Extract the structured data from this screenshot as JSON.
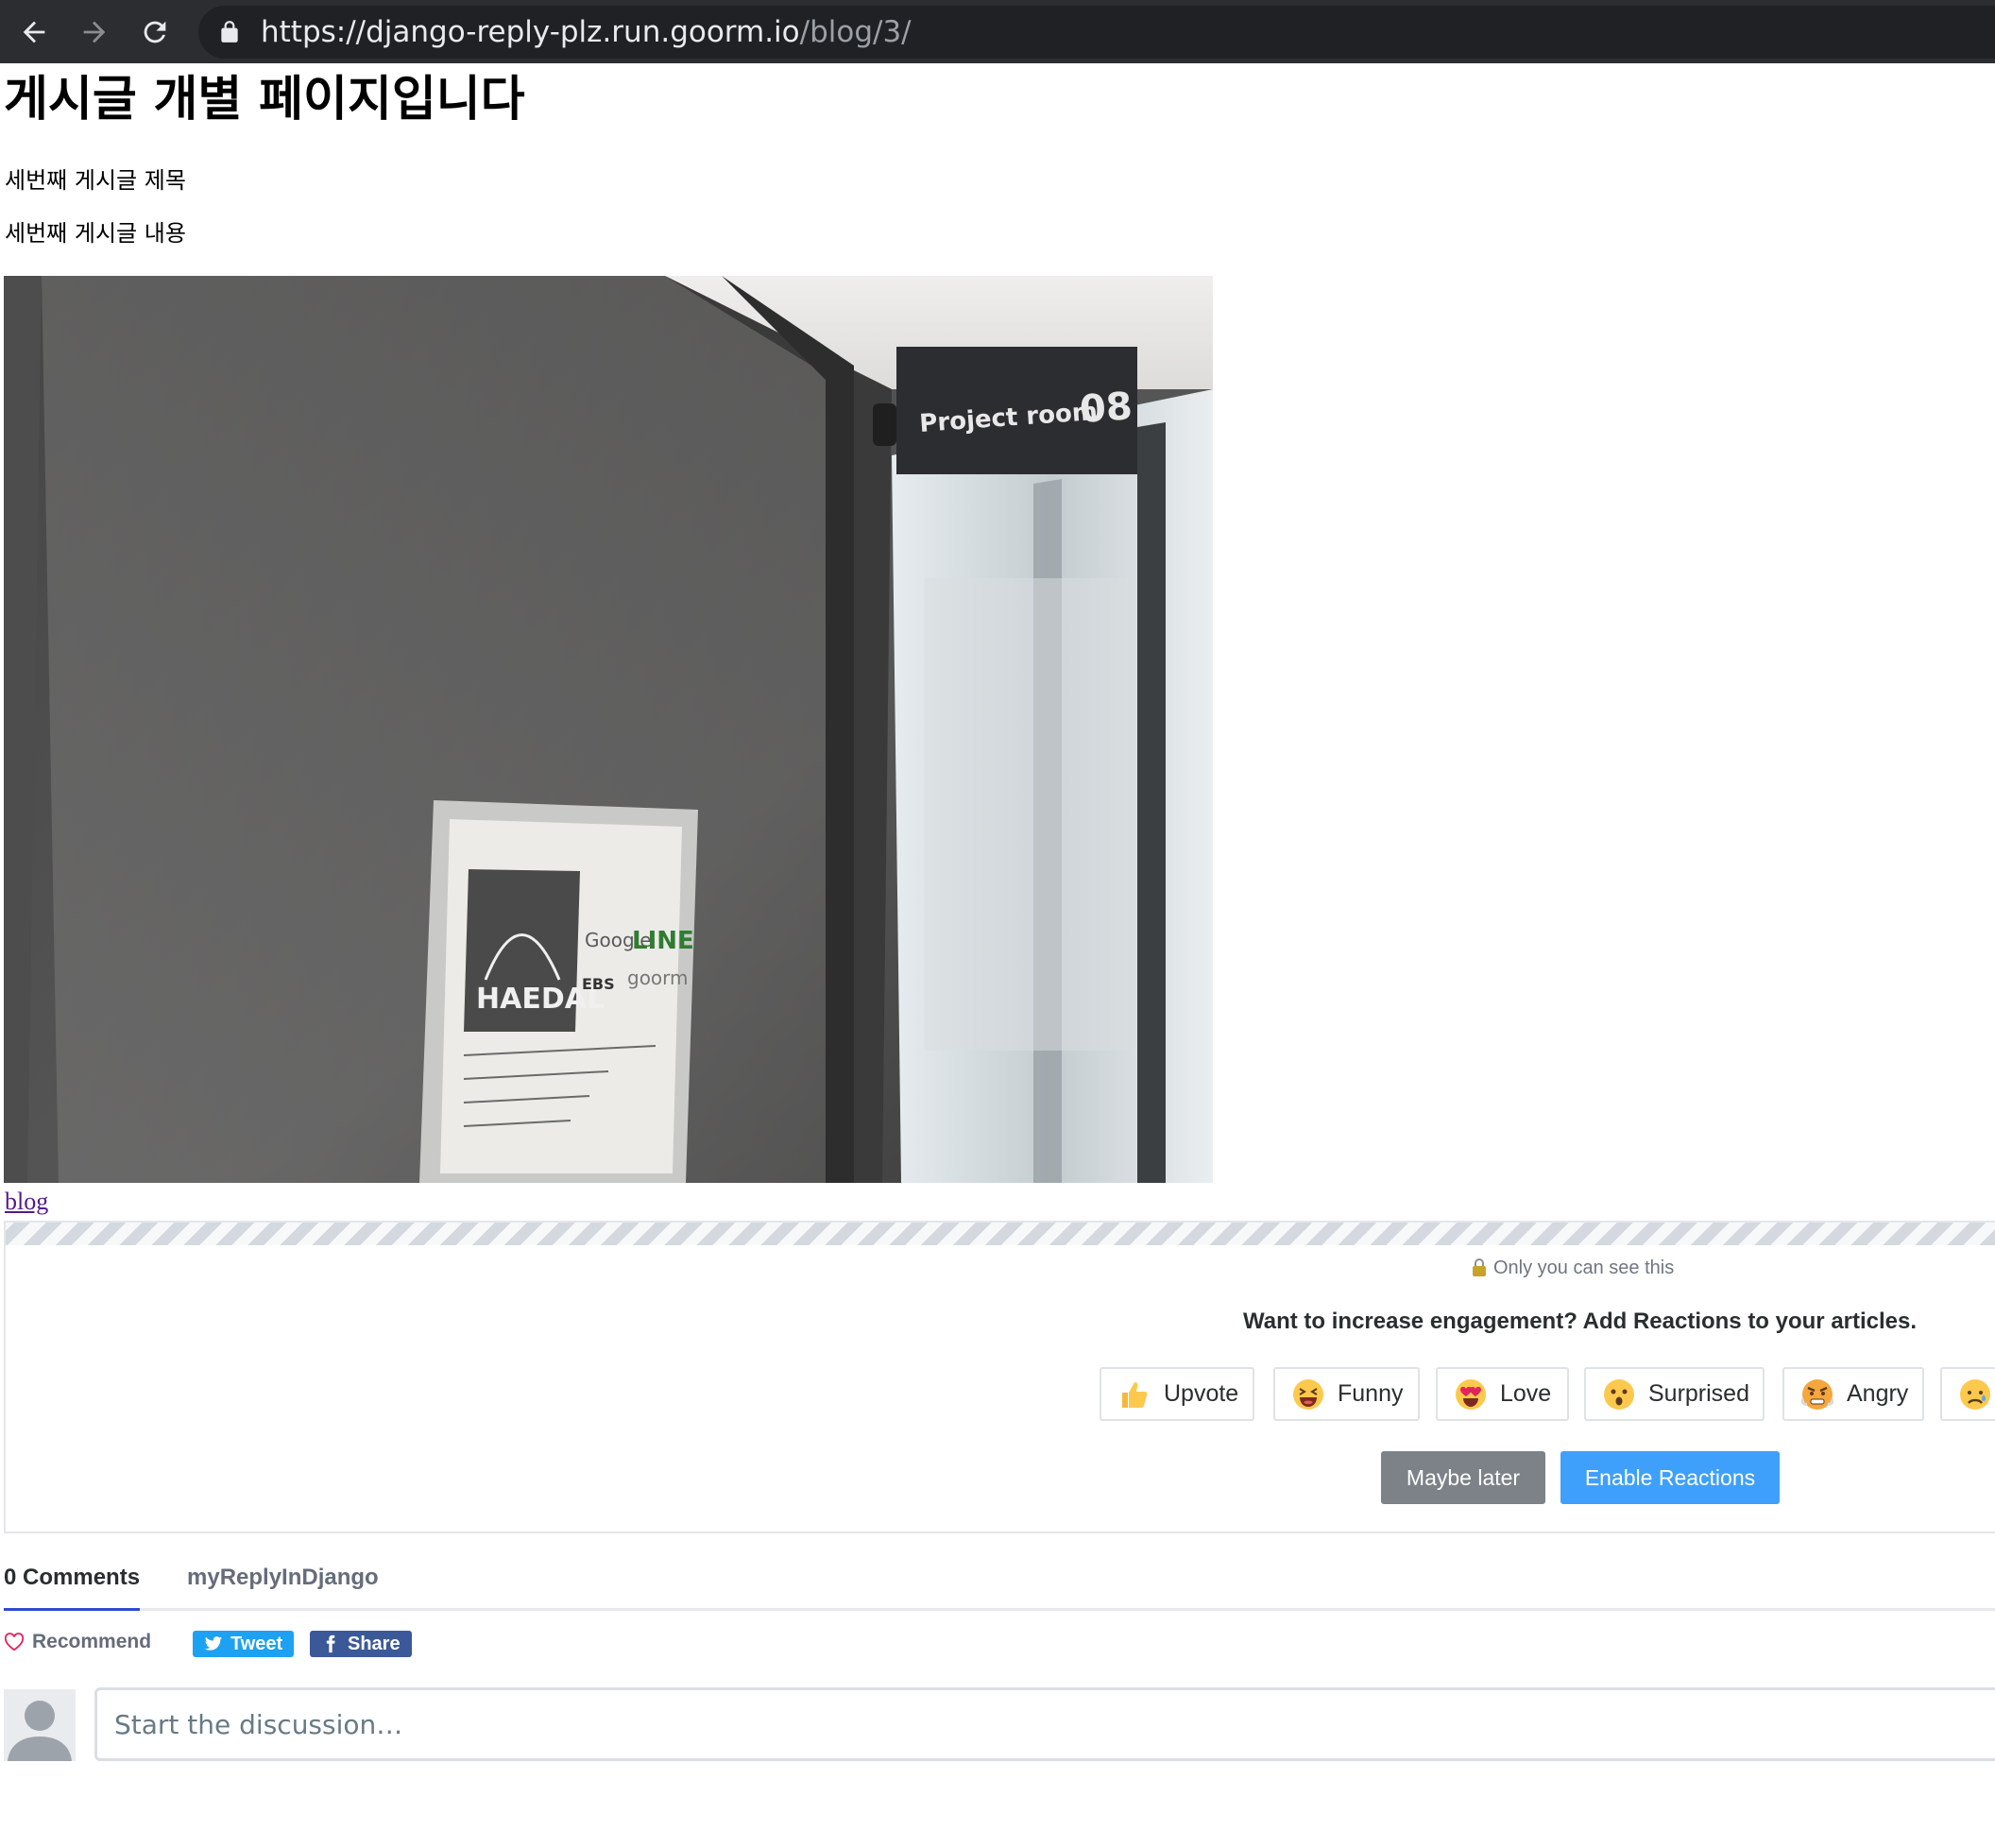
{
  "browser": {
    "url_scheme": "https://",
    "url_host": "django-reply-plz.run.goorm.io",
    "url_path": "/blog/3/"
  },
  "page": {
    "heading": "게시글 개별 페이지입니다",
    "post_title": "세번째 게시글 제목",
    "post_content": "세번째 게시글 내용",
    "back_link": "blog"
  },
  "photo": {
    "sign_text": "Project room",
    "sign_number": "08",
    "frame_logo": "HAEDAL",
    "frame_brands": [
      "Google",
      "LINE",
      "EBS",
      "goorm"
    ]
  },
  "reactions": {
    "private_note": "Only you can see this",
    "promo_text": "Want to increase engagement? Add Reactions to your articles.",
    "buttons": [
      "Upvote",
      "Funny",
      "Love",
      "Surprised",
      "Angry"
    ],
    "maybe_later": "Maybe later",
    "enable": "Enable Reactions"
  },
  "comments": {
    "count_tab": "0 Comments",
    "forum_tab": "myReplyInDjango",
    "recommend": "Recommend",
    "tweet": "Tweet",
    "share": "Share",
    "placeholder": "Start the discussion…"
  },
  "colors": {
    "chrome_bg": "#2b2d30",
    "omnibox_bg": "#202124",
    "link_visited": "#551a8b",
    "enable_button": "#3ea0fa",
    "later_button": "#7c8287",
    "tab_underline": "#2e4bd1",
    "tweet": "#1da1f2",
    "facebook": "#3b5998",
    "recommend_heart": "#e0245e"
  },
  "icons": [
    "back-arrow-icon",
    "forward-arrow-icon",
    "reload-icon",
    "lock-icon",
    "thumbs-up-icon",
    "laughing-face-icon",
    "heart-eyes-icon",
    "surprised-face-icon",
    "angry-face-icon",
    "sad-face-icon",
    "heart-icon",
    "twitter-bird-icon",
    "facebook-icon",
    "user-avatar-icon"
  ]
}
